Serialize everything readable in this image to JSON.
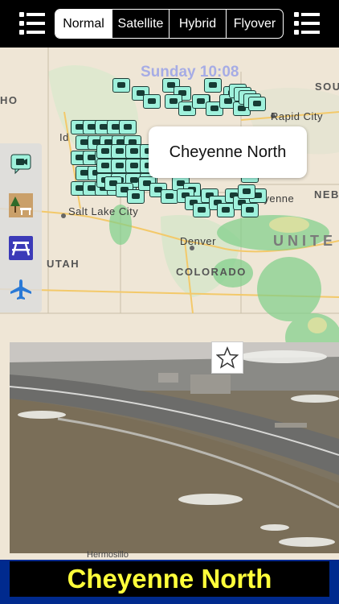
{
  "map_types": [
    "Normal",
    "Satellite",
    "Hybrid",
    "Flyover"
  ],
  "selected_map_type": "Normal",
  "timestamp": "Sunday 10:08",
  "callout_title": "Cheyenne North",
  "map_labels": {
    "states": [
      "UTAH",
      "COLORADO",
      "SOU DAKO",
      "NEB",
      "UNITE"
    ],
    "cities": [
      "Salt Lake City",
      "Denver",
      "Rapid City",
      "Cheyenne",
      "Id",
      "HO",
      "Hermosillo"
    ]
  },
  "sidebar": [
    "camera-icon",
    "rest-area-icon",
    "picnic-table-icon",
    "airport-icon"
  ],
  "camera_title": "Cheyenne North",
  "colors": {
    "marker": "#9ff1dc",
    "banner_bg": "#002a8e",
    "banner_text": "#ffff3a"
  }
}
